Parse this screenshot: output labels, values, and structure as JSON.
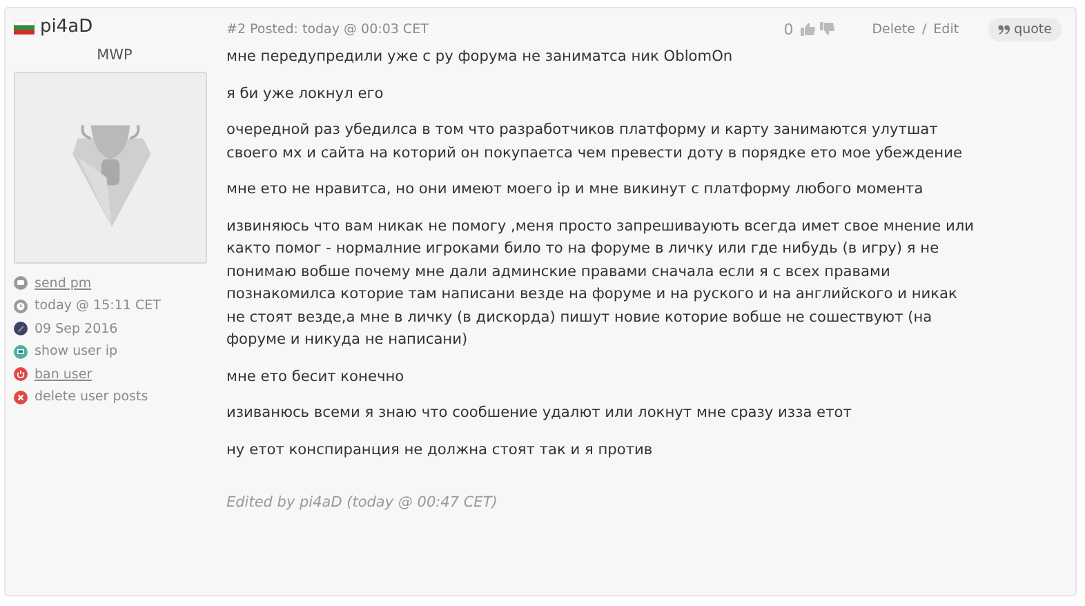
{
  "user": {
    "name": "pi4aD",
    "rank": "MWP",
    "links": [
      {
        "kind": "message",
        "text": "send pm",
        "link": true
      },
      {
        "kind": "clock",
        "text": "today @ 15:11 CET",
        "link": false
      },
      {
        "kind": "joined",
        "text": "09 Sep 2016",
        "link": false
      },
      {
        "kind": "ip",
        "text": "show user ip",
        "link": false
      },
      {
        "kind": "ban",
        "text": "ban user",
        "link": true
      },
      {
        "kind": "delete",
        "text": "delete user posts",
        "link": false
      }
    ]
  },
  "post": {
    "number": "#2",
    "posted": "Posted: today @ 00:03 CET",
    "score": "0",
    "actions": [
      "Delete",
      "Edit"
    ],
    "separator": "/",
    "quote": "quote",
    "paragraphs": [
      "мне передупредили уже с ру форума не заниматса ник OblomOn",
      "я би уже локнул его",
      "очередной раз убедилса в том что разработчиков платформу и карту занимаются улутшат своего мх и сайта на которий он покупаетса чем превести доту в порядке ето мое убеждение",
      "мне ето не нравитса, но они имеют моего ip и мне викинут с платформу любого момента",
      "извиняюсь что вам никак не помогу ,меня просто запрешиваують всегда имет свое мнение или както помог - нормалние игроками било то на форуме в личку или где нибудь (в игру) я не понимаю вобше почему мне дали админские правами сначала если я с всех правами познакомилса которие там написани везде на форуме и на руского и на английского и никак не стоят везде,а мне в личку (в дискорда) пишут новие которие вобше не сошествуют (на форуме и никуда не написани)",
      "мне ето бесит конечно",
      "изиванюсь всеми я знаю что сообшение удалют или локнут мне сразу изза етот",
      "ну етот конспиранция не должна стоят так и я против"
    ],
    "edited": "Edited by pi4aD (today @ 00:47 CET)"
  }
}
